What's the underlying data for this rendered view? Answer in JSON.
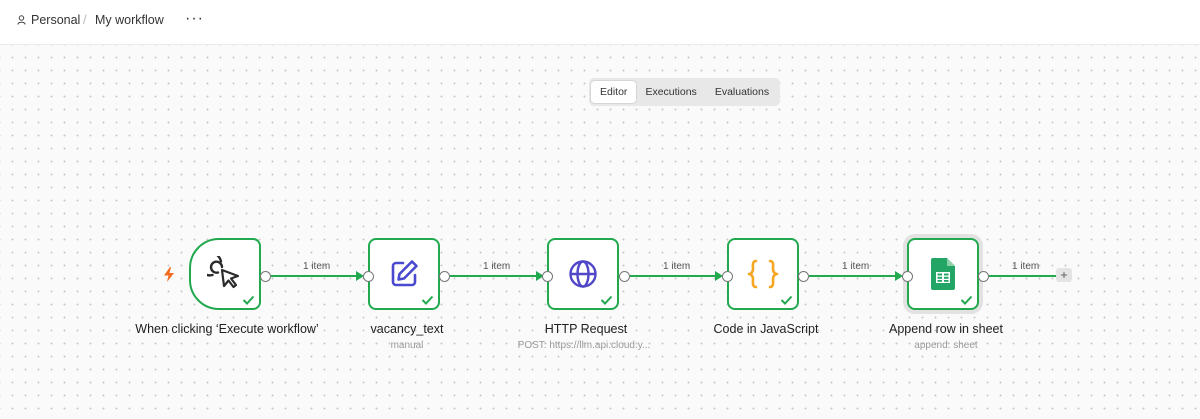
{
  "breadcrumb": {
    "project": "Personal",
    "separator": "/",
    "workflow": "My workflow",
    "more": "···"
  },
  "tabs": [
    {
      "label": "Editor",
      "active": true
    },
    {
      "label": "Executions",
      "active": false
    },
    {
      "label": "Evaluations",
      "active": false
    }
  ],
  "nodes": [
    {
      "name": "When clicking ‘Execute workflow’",
      "subtitle": "",
      "icon": "cursor-click-icon",
      "status": "success"
    },
    {
      "name": "vacancy_text",
      "subtitle": "manual",
      "icon": "pencil-edit-icon",
      "status": "success"
    },
    {
      "name": "HTTP Request",
      "subtitle": "POST: https://llm.api.cloud.y...",
      "icon": "globe-icon",
      "status": "success"
    },
    {
      "name": "Code in JavaScript",
      "subtitle": "",
      "icon": "code-braces-icon",
      "status": "success"
    },
    {
      "name": "Append row in sheet",
      "subtitle": "append: sheet",
      "icon": "google-sheets-icon",
      "status": "success"
    }
  ],
  "connections": [
    {
      "label": "1 item"
    },
    {
      "label": "1 item"
    },
    {
      "label": "1 item"
    },
    {
      "label": "1 item"
    },
    {
      "label": "1 item"
    }
  ],
  "add_node": "+",
  "colors": {
    "success": "#22a94f",
    "trigger_bolt": "#f26b21",
    "globe": "#4f46c8",
    "code": "#f5a623",
    "sheets": "#23a566",
    "pencil": "#4a4ad0"
  }
}
